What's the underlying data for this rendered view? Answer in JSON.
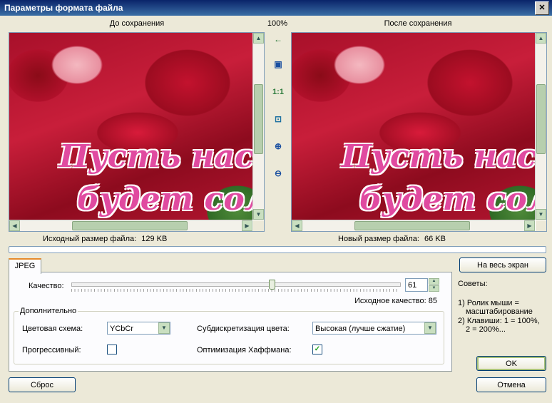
{
  "window": {
    "title": "Параметры формата файла",
    "close_label": "✕"
  },
  "preview": {
    "before_label": "До сохранения",
    "after_label": "После сохранения",
    "zoom": "100%",
    "image_text_line1": "Пусть настр",
    "image_text_line2": "будет солне",
    "original_size_label": "Исходный размер файла:",
    "original_size_value": "129 KB",
    "new_size_label": "Новый размер файла:",
    "new_size_value": "66 KB"
  },
  "tools": {
    "back_icon": "←",
    "fit_icon": "▣",
    "actual_size_label": "1:1",
    "fit_window_icon": "⊡",
    "zoom_in_icon": "⊕",
    "zoom_out_icon": "⊖"
  },
  "tab": {
    "label": "JPEG"
  },
  "quality": {
    "label": "Качество:",
    "value": "61",
    "slider_fraction": 0.61,
    "original_quality_label": "Исходное качество:",
    "original_quality_value": "85"
  },
  "advanced": {
    "title": "Дополнительно",
    "color_scheme_label": "Цветовая схема:",
    "color_scheme_value": "YCbCr",
    "subsampling_label": "Субдискретизация цвета:",
    "subsampling_value": "Высокая (лучше сжатие)",
    "progressive_label": "Прогрессивный:",
    "progressive_checked": false,
    "huffman_label": "Оптимизация Хаффмана:",
    "huffman_checked": true
  },
  "side": {
    "fullscreen_button": "На весь экран",
    "tips_title": "Советы:",
    "tip1_line1": "1) Ролик мыши =",
    "tip1_line2": "масштабирование",
    "tip2_line1": "2) Клавиши: 1 = 100%,",
    "tip2_line2": "2 = 200%..."
  },
  "buttons": {
    "reset": "Сброс",
    "ok": "OK",
    "cancel": "Отмена"
  },
  "colors": {
    "accent": "#e68b2c",
    "titlebar": "#0a246a",
    "scroll": "#c9dfc0"
  },
  "icons": {
    "check": "✓"
  }
}
